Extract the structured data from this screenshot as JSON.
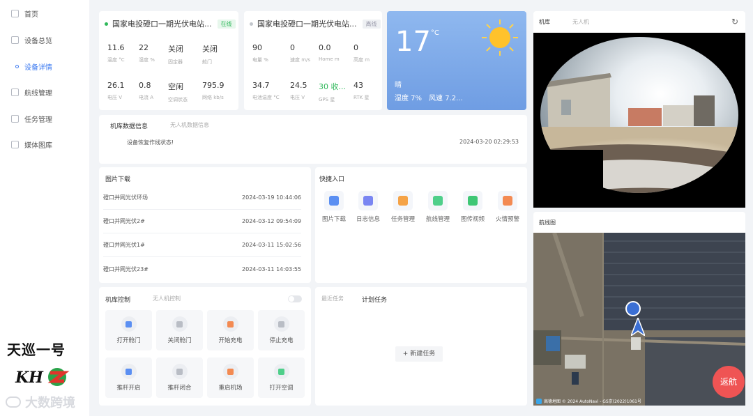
{
  "sidebar": {
    "items": [
      {
        "label": "首页"
      },
      {
        "label": "设备总览"
      },
      {
        "label": "设备详情"
      },
      {
        "label": "航线管理"
      },
      {
        "label": "任务管理"
      },
      {
        "label": "媒体图库"
      }
    ]
  },
  "brand": {
    "logo_text": "天巡一号"
  },
  "watermark": {
    "text": "大数跨境"
  },
  "station1": {
    "title": "国家电投磴口一期光伏电站...",
    "status": "在线",
    "metrics": [
      {
        "value": "11.6",
        "label": "温度 °C"
      },
      {
        "value": "22",
        "label": "湿度 %"
      },
      {
        "value": "关闭",
        "label": "固定器"
      },
      {
        "value": "关闭",
        "label": "舱门"
      },
      {
        "value": "26.1",
        "label": "电压 V"
      },
      {
        "value": "0.8",
        "label": "电流 A"
      },
      {
        "value": "空闲",
        "label": "空调状态"
      },
      {
        "value": "795.9",
        "label": "网络 kb/s"
      }
    ]
  },
  "station2": {
    "title": "国家电投磴口一期光伏电站...",
    "status": "离线",
    "metrics": [
      {
        "value": "90",
        "label": "电量 %"
      },
      {
        "value": "0",
        "label": "速度 m/s"
      },
      {
        "value": "0.0",
        "label": "Home m"
      },
      {
        "value": "0",
        "label": "高度 m"
      },
      {
        "value": "34.7",
        "label": "电池温度 °C"
      },
      {
        "value": "24.5",
        "label": "电压 V"
      },
      {
        "value": "30 收...",
        "label": "GPS 星"
      },
      {
        "value": "43",
        "label": "RTK 星"
      }
    ]
  },
  "weather": {
    "temp": "17",
    "unit": "°C",
    "condition": "晴",
    "humidity": "湿度 7%",
    "wind": "风速 7.2..."
  },
  "messages": {
    "tabs": [
      "机库数据信息",
      "无人机数据信息"
    ],
    "text": "设备恢复作线状态!",
    "time": "2024-03-20 02:29:53"
  },
  "downloads": {
    "title": "图片下载",
    "rows": [
      {
        "name": "磴口并网光伏环场",
        "time": "2024-03-19 10:44:06"
      },
      {
        "name": "磴口并网光伏2#",
        "time": "2024-03-12 09:54:09"
      },
      {
        "name": "磴口并网光伏1#",
        "time": "2024-03-11 15:02:56"
      },
      {
        "name": "磴口并网光伏23#",
        "time": "2024-03-11 14:03:55"
      }
    ]
  },
  "quick": {
    "title": "快捷入口",
    "items": [
      {
        "label": "图片下载",
        "color": "#5b8ff2"
      },
      {
        "label": "日志信息",
        "color": "#7a86f2"
      },
      {
        "label": "任务管理",
        "color": "#f5a347"
      },
      {
        "label": "航线管理",
        "color": "#4fcf8a"
      },
      {
        "label": "图传视频",
        "color": "#3fc775"
      },
      {
        "label": "火情预警",
        "color": "#f38a52"
      }
    ]
  },
  "control": {
    "tabs": [
      "机库控制",
      "无人机控制"
    ],
    "buttons": [
      {
        "label": "打开舱门",
        "color": "#5b8ff2"
      },
      {
        "label": "关闭舱门",
        "color": "#b9bdc5"
      },
      {
        "label": "开始充电",
        "color": "#f38a52"
      },
      {
        "label": "停止充电",
        "color": "#b9bdc5"
      },
      {
        "label": "推杆开启",
        "color": "#5b8ff2"
      },
      {
        "label": "推杆闭合",
        "color": "#b9bdc5"
      },
      {
        "label": "重启机场",
        "color": "#f38a52"
      },
      {
        "label": "打开空调",
        "color": "#4fcf8a"
      }
    ]
  },
  "tasks": {
    "tabs": [
      "最近任务",
      "计划任务"
    ],
    "new_task": "+ 新建任务"
  },
  "camera": {
    "tabs": [
      "机库",
      "无人机"
    ]
  },
  "route_map": {
    "title": "航线图",
    "attribution": "高德地图 © 2024 AutoNavi - GS京(2022)1061号",
    "return_button": "返航"
  }
}
